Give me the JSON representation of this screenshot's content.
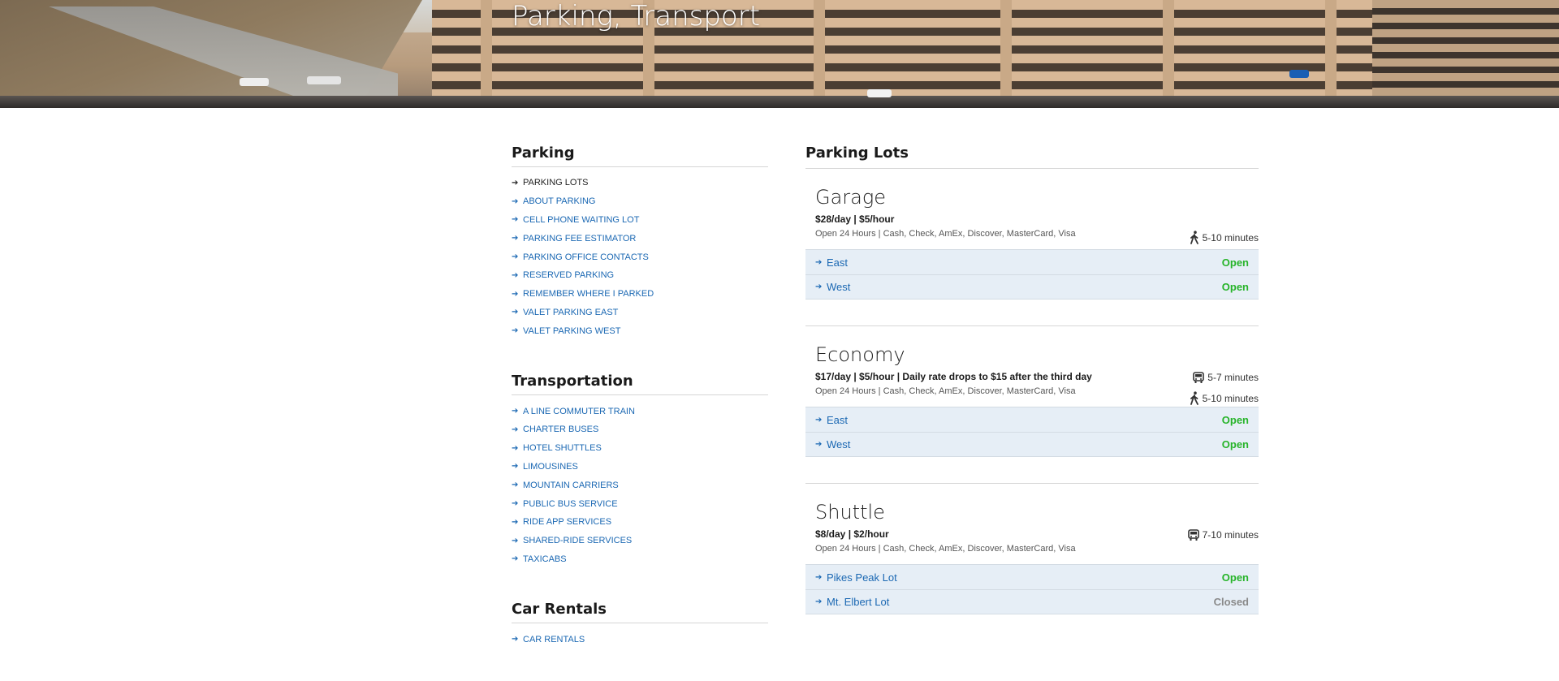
{
  "hero": {
    "title": "Parking, Transport"
  },
  "sidebar": {
    "sections": [
      {
        "title": "Parking",
        "items": [
          {
            "label": "PARKING LOTS",
            "current": true
          },
          {
            "label": "ABOUT PARKING"
          },
          {
            "label": "CELL PHONE WAITING LOT"
          },
          {
            "label": "PARKING FEE ESTIMATOR"
          },
          {
            "label": "PARKING OFFICE CONTACTS"
          },
          {
            "label": "RESERVED PARKING"
          },
          {
            "label": "REMEMBER WHERE I PARKED"
          },
          {
            "label": "VALET PARKING EAST"
          },
          {
            "label": "VALET PARKING WEST"
          }
        ]
      },
      {
        "title": "Transportation",
        "items": [
          {
            "label": "A LINE COMMUTER TRAIN"
          },
          {
            "label": "CHARTER BUSES"
          },
          {
            "label": "HOTEL SHUTTLES"
          },
          {
            "label": "LIMOUSINES"
          },
          {
            "label": "MOUNTAIN CARRIERS"
          },
          {
            "label": "PUBLIC BUS SERVICE"
          },
          {
            "label": "RIDE APP SERVICES"
          },
          {
            "label": "SHARED-RIDE SERVICES"
          },
          {
            "label": "TAXICABS"
          }
        ]
      },
      {
        "title": "Car Rentals",
        "items": [
          {
            "label": "CAR RENTALS"
          }
        ]
      }
    ]
  },
  "main": {
    "title": "Parking Lots",
    "lots": [
      {
        "name": "Garage",
        "rate": "$28/day | $5/hour",
        "payment": "Open 24 Hours | Cash, Check, AmEx, Discover, MasterCard, Visa",
        "times": [
          {
            "icon": "walk-icon",
            "text": "5-10 minutes"
          }
        ],
        "subs": [
          {
            "label": "East",
            "status": "Open"
          },
          {
            "label": "West",
            "status": "Open"
          }
        ]
      },
      {
        "name": "Economy",
        "rate": "$17/day | $5/hour | Daily rate drops to $15 after the third day",
        "payment": "Open 24 Hours | Cash, Check, AmEx, Discover, MasterCard, Visa",
        "times": [
          {
            "icon": "bus-icon",
            "text": "5-7 minutes"
          },
          {
            "icon": "walk-icon",
            "text": "5-10 minutes"
          }
        ],
        "subs": [
          {
            "label": "East",
            "status": "Open"
          },
          {
            "label": "West",
            "status": "Open"
          }
        ]
      },
      {
        "name": "Shuttle",
        "rate": "$8/day | $2/hour",
        "payment": "Open 24 Hours | Cash, Check, AmEx, Discover, MasterCard, Visa",
        "times": [
          {
            "icon": "bus-icon",
            "text": "7-10 minutes"
          }
        ],
        "subs": [
          {
            "label": "Pikes Peak Lot",
            "status": "Open"
          },
          {
            "label": "Mt. Elbert Lot",
            "status": "Closed"
          }
        ]
      }
    ]
  },
  "colors": {
    "link": "#1b68b3",
    "open": "#27b42a",
    "closed": "#8a8a8a",
    "row_bg": "#e6eef6"
  }
}
